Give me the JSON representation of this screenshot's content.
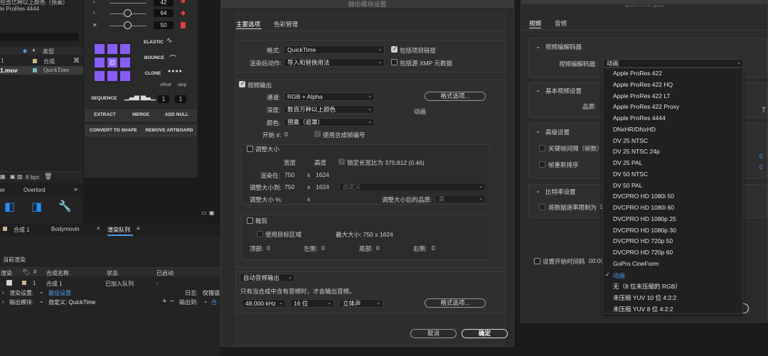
{
  "project": {
    "top_line1": "包含亿种以上颜色（预乘）",
    "top_line2": "le ProRes 4444",
    "col_type": "类型",
    "row1_num": "1",
    "row1_type": "合成",
    "row2_name": "1.mov",
    "row2_type": "QuickTime",
    "bpc": "8 bpc"
  },
  "overlord": {
    "panel_title": "Overlord",
    "tab_left": "er",
    "num1": "42",
    "num2": "64",
    "num3": "50",
    "elastic": "ELASTIC",
    "bounce": "BOUNCE",
    "clone": "CLONE",
    "offset": "offset",
    "step": "step",
    "sequence": "SEQUENCE",
    "seq_a": "1",
    "seq_b": "1",
    "extract": "EXTRACT",
    "merge": "MERGE",
    "add_null": "ADD NULL",
    "convert": "CONVERT TO SHAPE",
    "remove": "REMOVE ARTBOARD"
  },
  "render_queue": {
    "tab1": "合成 1",
    "tab2": "Bodymovin",
    "tab3": "渲染队列",
    "current": "当前渲染",
    "col_render": "渲染",
    "col_name": "合成名称",
    "col_status": "状态",
    "col_started": "已启动",
    "row_num": "1",
    "row_name": "合成 1",
    "row_status": "已加入队列",
    "row_started": "-",
    "settings_label": "渲染设置:",
    "settings_value": "最佳设置",
    "output_label": "输出模块:",
    "output_value": "自定义: QuickTime",
    "log_label": "日志:",
    "log_value": "仅错误",
    "output_to": "输出到:",
    "output_to_val": "合"
  },
  "output_module": {
    "title": "输出模块设置",
    "tab_main": "主要选项",
    "tab_color": "色彩管理",
    "format_label": "格式:",
    "format_value": "QuickTime",
    "include_link": "包括项目链接",
    "post_label": "渲染后动作:",
    "post_value": "导入和替换用法",
    "include_xmp": "包括源 XMP 元数据",
    "video_output": "视频输出",
    "channels_label": "通道:",
    "channels_value": "RGB + Alpha",
    "format_options": "格式选项...",
    "depth_label": "深度:",
    "depth_value": "数百万种以上颜色",
    "codec_summary": "动画",
    "color_label": "颜色:",
    "color_value": "预乘（遮罩）",
    "start_label": "开始 #:",
    "start_value": "0",
    "use_comp_frame": "使用合成帧编号",
    "resize": "调整大小",
    "width_h": "宽度",
    "height_h": "高度",
    "lock_ratio": "锁定长宽比为 375:812 (0.46)",
    "render_at": "渲染在:",
    "render_w": "750",
    "render_h": "1624",
    "resize_to": "调整大小到:",
    "resize_w": "750",
    "resize_h": "1624",
    "custom": "自定义",
    "resize_pct": "调整大小 %:",
    "x": "x",
    "quality_after": "调整大小后的品质:",
    "quality_value": "高",
    "crop": "裁剪",
    "use_roi": "使用目标区域",
    "max_size": "最大大小: 750 x 1624",
    "top": "顶部:",
    "top_v": "0",
    "left": "左侧:",
    "left_v": "0",
    "bottom": "底部:",
    "bottom_v": "0",
    "right": "右侧:",
    "right_v": "0",
    "audio_auto": "自动音频输出",
    "audio_note": "只有当合成中含有音频时，才会输出音频。",
    "rate": "48.000 kHz",
    "bits": "16 位",
    "stereo": "立体声",
    "audio_options": "格式选项...",
    "cancel": "取消",
    "ok": "确定"
  },
  "quicktime": {
    "title": "QuickTime 选项",
    "tab_video": "视频",
    "tab_audio": "音频",
    "sec_codec": "视频编解码器",
    "codec_label": "视频编解码器:",
    "codec_value": "动画",
    "sec_basic": "基本视频设置",
    "quality": "品质:",
    "sec_advanced": "高级设置",
    "keyframe": "关键帧间隔（帧数）",
    "frame_reorder": "帧重新排序",
    "sec_bitrate": "比特率设置",
    "limit_bitrate": "将数据速率限制为",
    "limit_bitrate_v": "1",
    "set_timecode": "设置开始时间码",
    "timecode_v": "00:00",
    "edge_T": "T",
    "edge_n1": "0",
    "edge_n2": "0"
  },
  "codec_list": [
    "Apple ProRes 422",
    "Apple ProRes 422 HQ",
    "Apple ProRes 422 LT",
    "Apple ProRes 422 Proxy",
    "Apple ProRes 4444",
    "DNxHR/DNxHD",
    "DV 25 NTSC",
    "DV 25 NTSC 24p",
    "DV 25 PAL",
    "DV 50 NTSC",
    "DV 50 PAL",
    "DVCPRO HD 1080i 50",
    "DVCPRO HD 1080i 60",
    "DVCPRO HD 1080p 25",
    "DVCPRO HD 1080p 30",
    "DVCPRO HD 720p 50",
    "DVCPRO HD 720p 60",
    "GoPro CineForm",
    "动画",
    "无（8 位未压缩的 RGB）",
    "未压缩 YUV 10 位 4:2:2",
    "未压缩 YUV 8 位 4:2:2"
  ],
  "codec_selected_index": 18,
  "colors": {
    "accent": "#4a9cf0",
    "purple": "#8a5cf7",
    "icon_blue": "#1e90ff"
  }
}
